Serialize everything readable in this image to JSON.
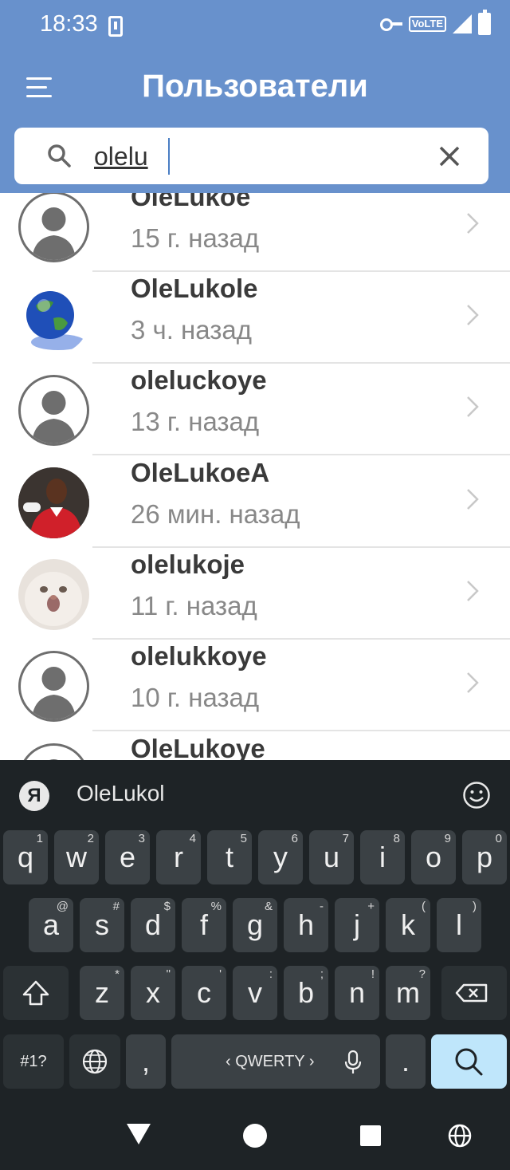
{
  "status_bar": {
    "time": "18:33",
    "network_badge": "VoLTE",
    "icons": [
      "download-icon",
      "key-icon",
      "signal-icon",
      "battery-icon"
    ]
  },
  "header": {
    "title": "Пользователи",
    "menu_icon": "menu-icon",
    "background_color": "#6891cc"
  },
  "search": {
    "value": "olelu",
    "icon": "search-icon",
    "clear_icon": "close-icon"
  },
  "users": [
    {
      "name": "OleLukoe",
      "last_seen": "15 г. назад",
      "avatar": "default-avatar"
    },
    {
      "name": "OleLukole",
      "last_seen": "3 ч. назад",
      "avatar": "globe-avatar"
    },
    {
      "name": "oleluckoye",
      "last_seen": "13 г. назад",
      "avatar": "default-avatar"
    },
    {
      "name": "OleLukoeA",
      "last_seen": "26 мин. назад",
      "avatar": "footballer-avatar"
    },
    {
      "name": "olelukoje",
      "last_seen": "11 г. назад",
      "avatar": "cat-avatar"
    },
    {
      "name": "olelukkoye",
      "last_seen": "10 г. назад",
      "avatar": "default-avatar"
    },
    {
      "name": "OleLukoye",
      "last_seen": "",
      "avatar": "default-avatar"
    }
  ],
  "keyboard": {
    "suggestion_logo": "Я",
    "suggestion": "OleLukol",
    "row1": [
      {
        "k": "q",
        "s": "1"
      },
      {
        "k": "w",
        "s": "2"
      },
      {
        "k": "e",
        "s": "3"
      },
      {
        "k": "r",
        "s": "4"
      },
      {
        "k": "t",
        "s": "5"
      },
      {
        "k": "y",
        "s": "6"
      },
      {
        "k": "u",
        "s": "7"
      },
      {
        "k": "i",
        "s": "8"
      },
      {
        "k": "o",
        "s": "9"
      },
      {
        "k": "p",
        "s": "0"
      }
    ],
    "row2": [
      {
        "k": "a",
        "s": "@"
      },
      {
        "k": "s",
        "s": "#"
      },
      {
        "k": "d",
        "s": "$"
      },
      {
        "k": "f",
        "s": "%"
      },
      {
        "k": "g",
        "s": "&"
      },
      {
        "k": "h",
        "s": "-"
      },
      {
        "k": "j",
        "s": "+"
      },
      {
        "k": "k",
        "s": "("
      },
      {
        "k": "l",
        "s": ")"
      }
    ],
    "row3": [
      {
        "k": "z",
        "s": "*"
      },
      {
        "k": "x",
        "s": "\""
      },
      {
        "k": "c",
        "s": "'"
      },
      {
        "k": "v",
        "s": ":"
      },
      {
        "k": "b",
        "s": ";"
      },
      {
        "k": "n",
        "s": "!"
      },
      {
        "k": "m",
        "s": "?"
      }
    ],
    "symbols_key": "#1?",
    "comma_key": ",",
    "space_label": "‹ QWERTY ›",
    "period_key": ".",
    "search_key_color": "#bfe6fb"
  },
  "nav_bar": {
    "icons": [
      "back-icon",
      "home-icon",
      "recents-icon",
      "globe-icon"
    ]
  }
}
